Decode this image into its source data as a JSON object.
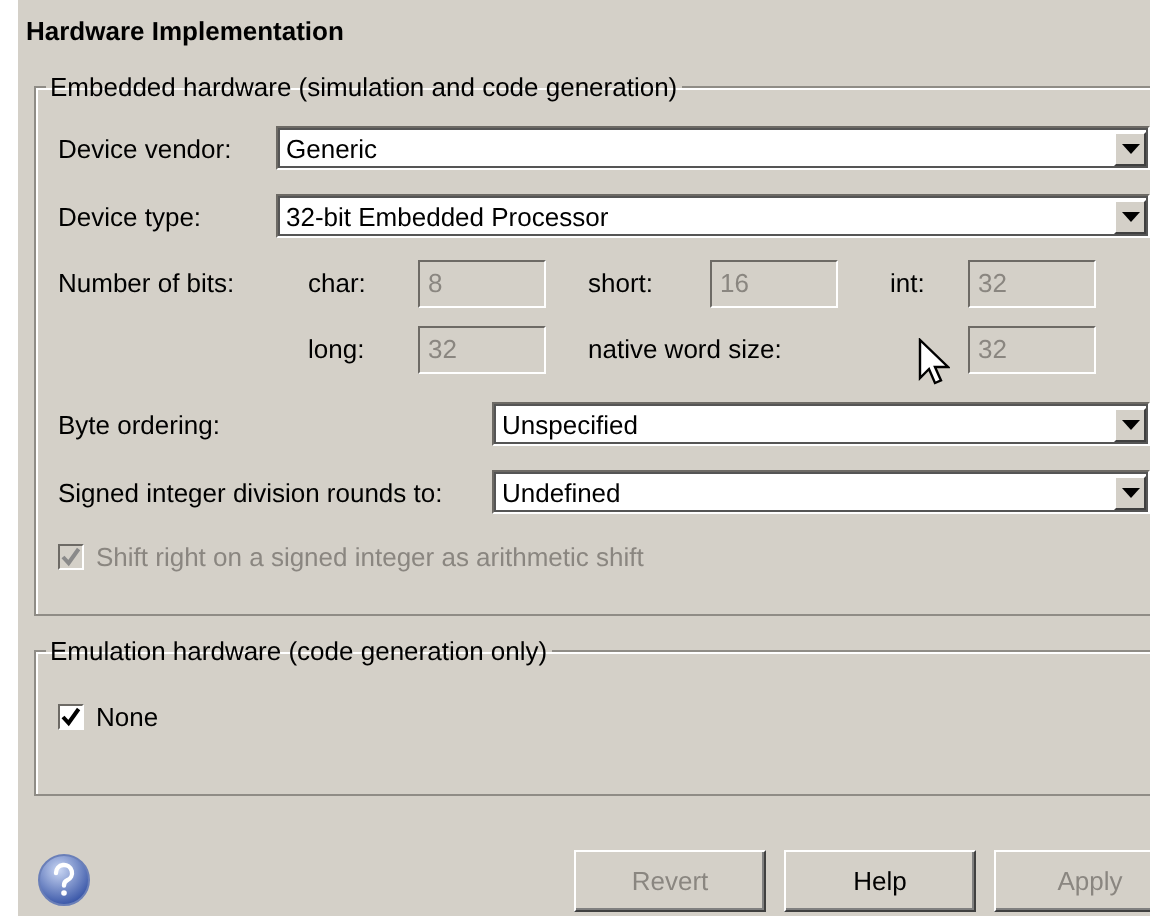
{
  "title": "Hardware Implementation",
  "embedded": {
    "legend": "Embedded hardware (simulation and code generation)",
    "vendor": {
      "label": "Device vendor:",
      "value": "Generic"
    },
    "type": {
      "label": "Device type:",
      "value": "32-bit Embedded Processor"
    },
    "bits_label": "Number of bits:",
    "bits": [
      {
        "label": "char:",
        "value": "8",
        "disabled": true
      },
      {
        "label": "short:",
        "value": "16",
        "disabled": true
      },
      {
        "label": "int:",
        "value": "32",
        "disabled": true
      },
      {
        "label": "long:",
        "value": "32",
        "disabled": true
      },
      {
        "label": "native word size:",
        "value": "32",
        "disabled": true
      }
    ],
    "byte_ordering": {
      "label": "Byte ordering:",
      "value": "Unspecified"
    },
    "division": {
      "label": "Signed integer division rounds to:",
      "value": "Undefined"
    },
    "shift": {
      "label": "Shift right on a signed integer as arithmetic shift",
      "checked": true,
      "disabled": true
    }
  },
  "emulation": {
    "legend": "Emulation hardware (code generation only)",
    "none": {
      "label": "None",
      "checked": true,
      "disabled": false
    }
  },
  "buttons": [
    {
      "label": "Revert",
      "disabled": true
    },
    {
      "label": "Help",
      "disabled": false
    },
    {
      "label": "Apply",
      "disabled": true
    }
  ]
}
